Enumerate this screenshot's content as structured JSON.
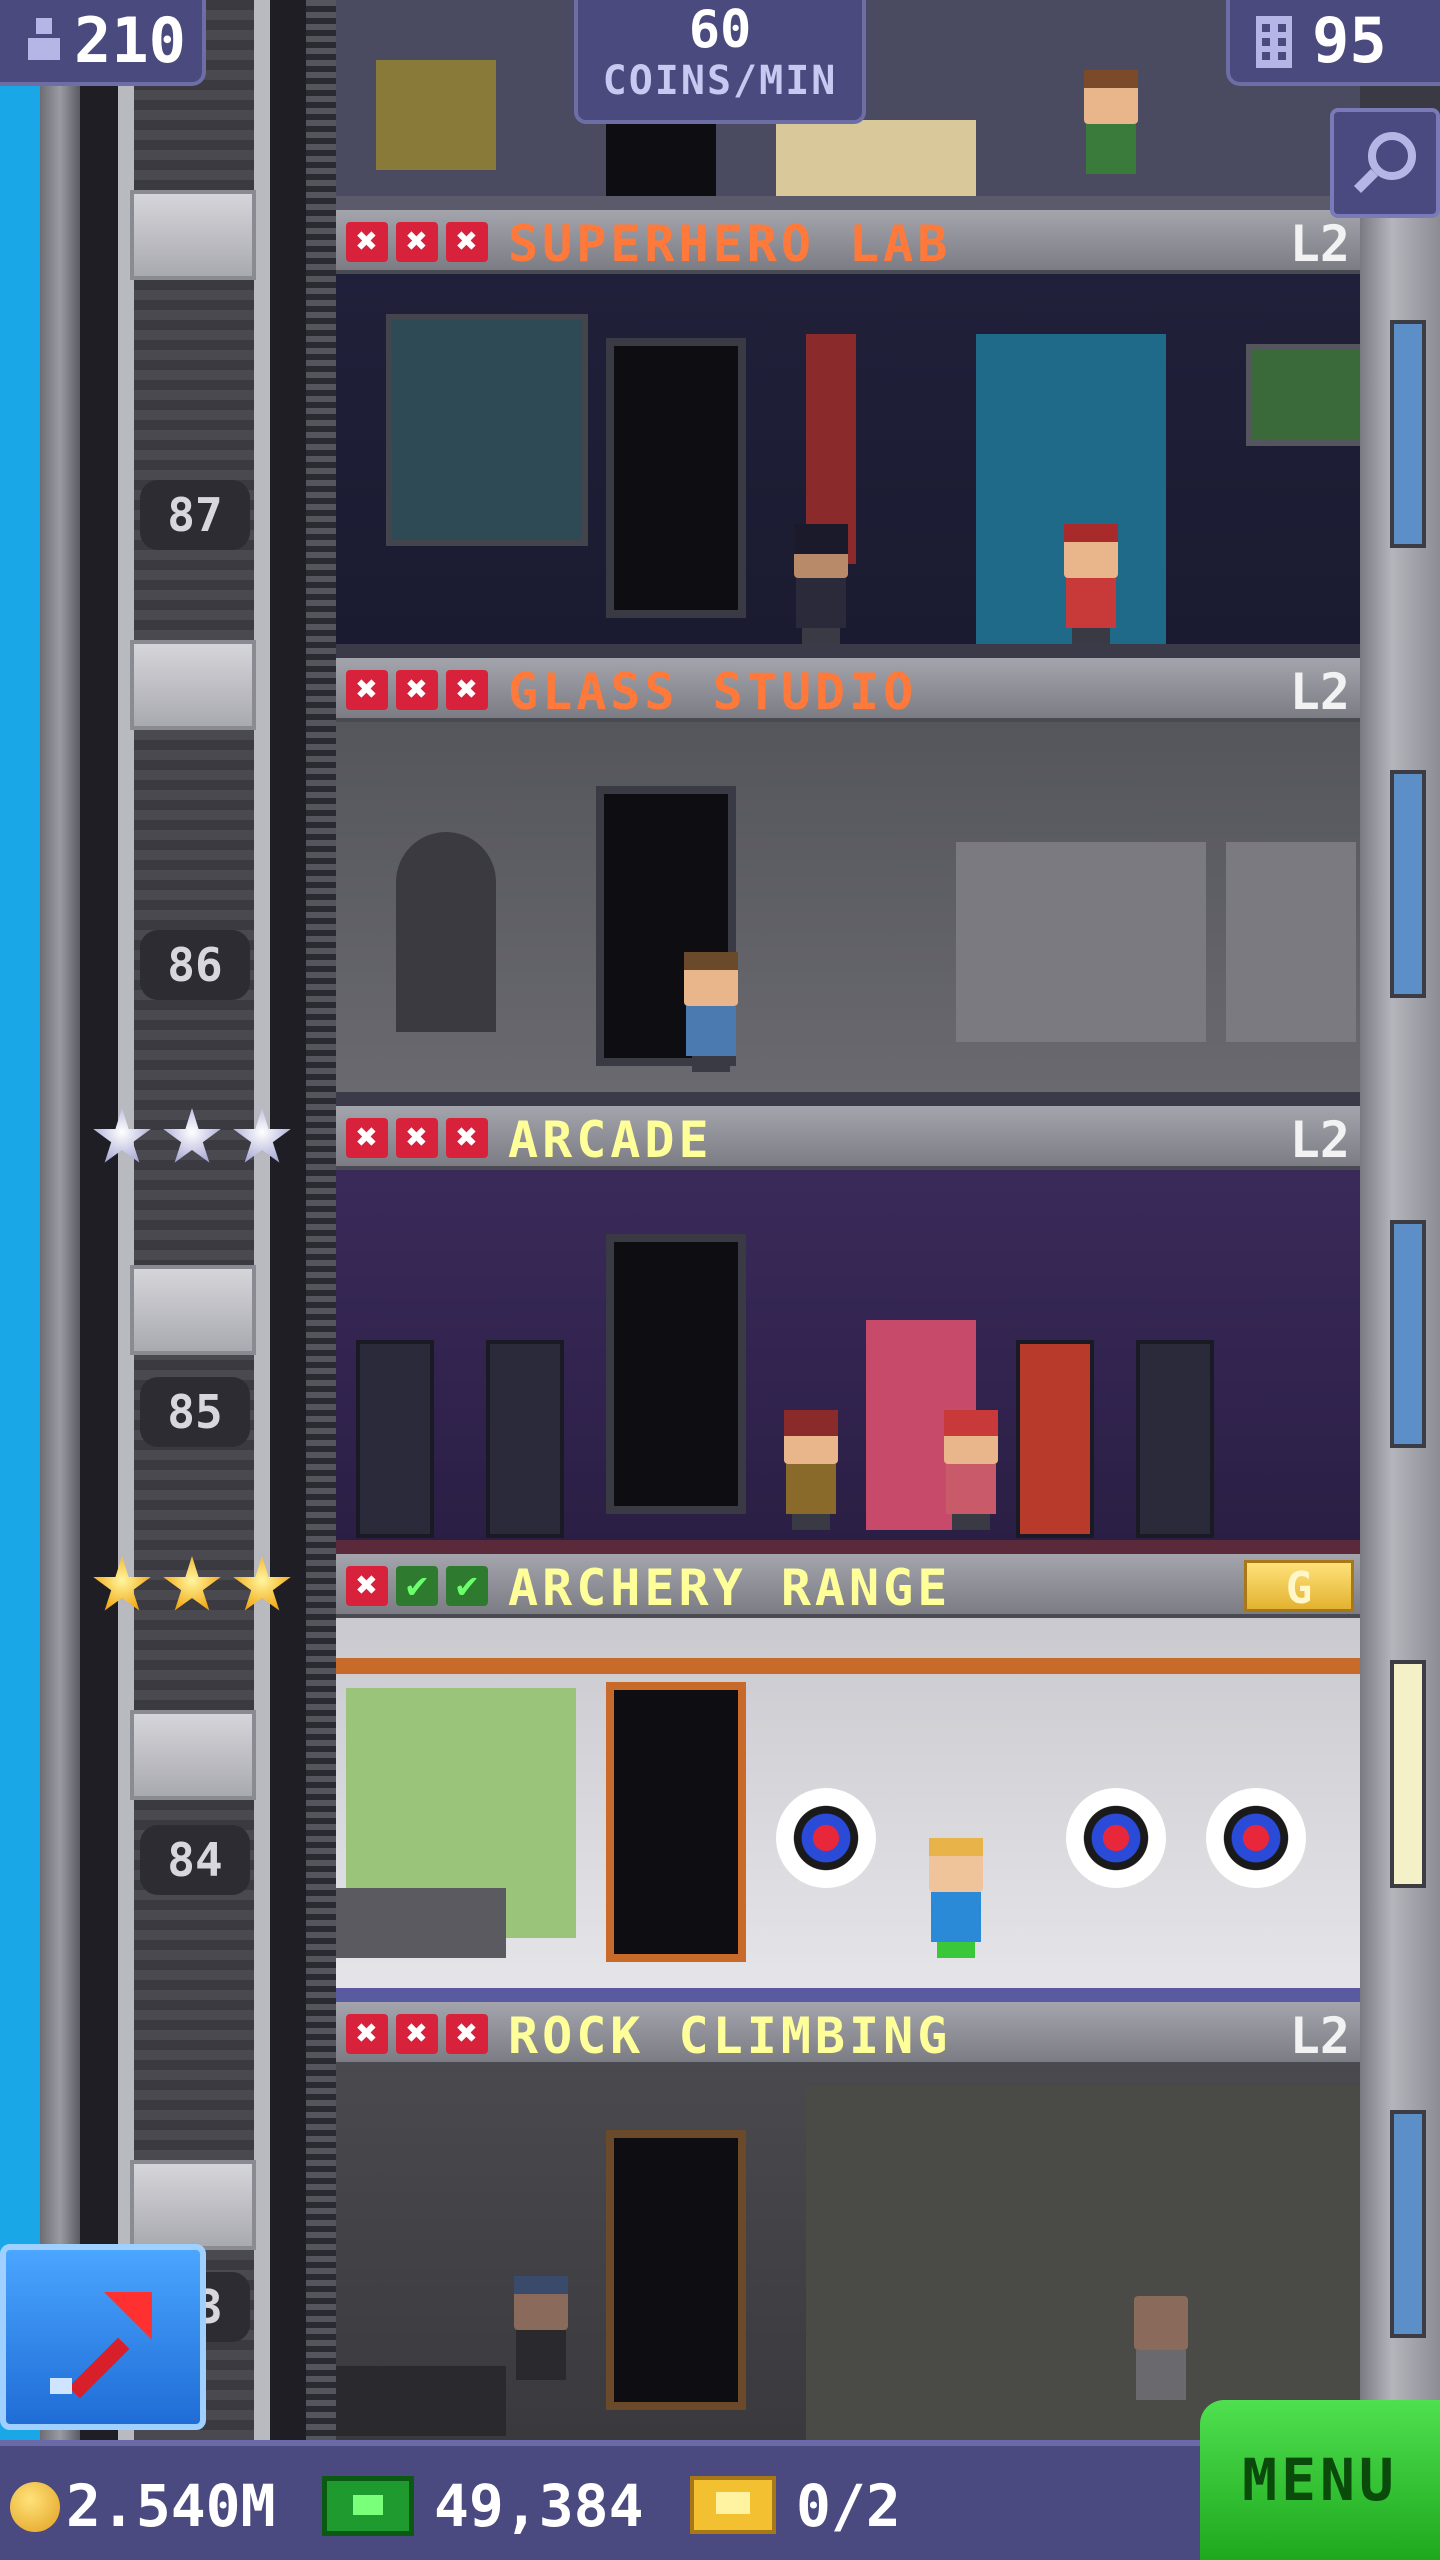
{
  "header": {
    "population": "210",
    "coins_per_min_value": "60",
    "coins_per_min_label": "COINS/MIN",
    "floors_count": "95"
  },
  "floors": [
    {
      "name": "SUPERHERO LAB",
      "level": "L2",
      "floor_number": "87",
      "stocking": [
        "x",
        "x",
        "x"
      ],
      "title_color": "#ff7a3a",
      "stars": 0
    },
    {
      "name": "GLASS STUDIO",
      "level": "L2",
      "floor_number": "86",
      "stocking": [
        "x",
        "x",
        "x"
      ],
      "title_color": "#ff7a3a",
      "stars": 0
    },
    {
      "name": "ARCADE",
      "level": "L2",
      "floor_number": "85",
      "stocking": [
        "x",
        "x",
        "x"
      ],
      "title_color": "#ffff9a",
      "stars": 3,
      "star_type": "silver"
    },
    {
      "name": "ARCHERY RANGE",
      "level": "G",
      "floor_number": "84",
      "stocking": [
        "x",
        "c",
        "c"
      ],
      "title_color": "#ffff9a",
      "stars": 3,
      "star_type": "gold"
    },
    {
      "name": "ROCK CLIMBING",
      "level": "L2",
      "floor_number": "83",
      "stocking": [
        "x",
        "x",
        "x"
      ],
      "title_color": "#ffff9a",
      "stars": 0
    }
  ],
  "footer": {
    "coins": "2.540M",
    "bux": "49,384",
    "tickets": "0/2",
    "menu_label": "MENU"
  },
  "icons": {
    "population": "person-icon",
    "floors": "building-icon",
    "search": "magnifier-icon",
    "build": "arrow-up-right-icon",
    "coin": "coin-icon",
    "bux": "bux-icon",
    "ticket": "ticket-icon"
  },
  "colors": {
    "sky": "#1aa7e8",
    "ui_panel": "#4a4a80",
    "menu_green": "#2ec82e",
    "red_x": "#d8213a",
    "green_check": "#2e7a2e"
  }
}
